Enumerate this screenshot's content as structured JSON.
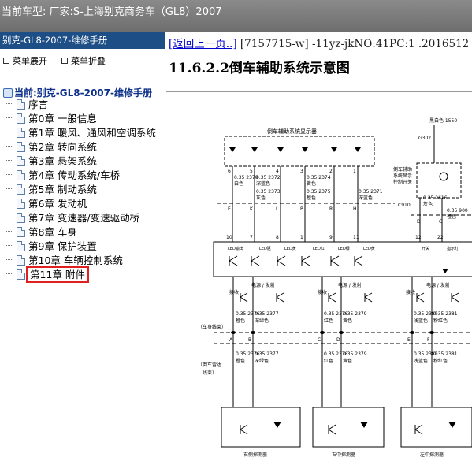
{
  "window": {
    "title": "当前车型:   厂家:S-上海别克商务车（GL8）2007"
  },
  "sidebar": {
    "header": "别克-GL8-2007-维修手册",
    "expand_all": "菜单展开",
    "collapse_all": "菜单折叠",
    "current": "当前:别克-GL8-2007-维修手册",
    "items": [
      {
        "label": "序言"
      },
      {
        "label": "第0章 一般信息"
      },
      {
        "label": "第1章 暖风、通风和空调系统"
      },
      {
        "label": "第2章 转向系统"
      },
      {
        "label": "第3章 悬架系统"
      },
      {
        "label": "第4章 传动系统/车桥"
      },
      {
        "label": "第5章 制动系统"
      },
      {
        "label": "第6章 发动机"
      },
      {
        "label": "第7章 变速器/变速驱动桥"
      },
      {
        "label": "第8章 车身"
      },
      {
        "label": "第9章 保护装置"
      },
      {
        "label": "第10章 车辆控制系统"
      },
      {
        "label": "第11章 附件",
        "selected": true
      }
    ]
  },
  "content": {
    "back_link": "[返回上一页..]",
    "doc_meta": " [7157715-w] -11yz-jkNO:41PC:1 .2016512",
    "page_title": "11.6.2.2倒车辅助系统示意图"
  },
  "diagram": {
    "display_title": "倒车辅助系统显示器",
    "top_wire": "黑白色 1550",
    "ground": "G302",
    "switch_label": [
      "倒车辅助",
      "系统显示",
      "控制开关"
    ],
    "connector_c910": "C910",
    "section_body_harness": "（车身线束）",
    "section_sensor_harness": [
      "（倒车雷达",
      "线束）"
    ],
    "power_label": "电源 / 发射",
    "receive_label": "接收",
    "sensor_labels": [
      "右侧探测器",
      "右中探测器",
      "左中探测器"
    ],
    "pin_top": [
      "6",
      "5",
      "4",
      "3",
      "2",
      "1"
    ],
    "pin_mid": [
      "10",
      "7",
      "8",
      "1",
      "9",
      "11",
      "12",
      "22"
    ],
    "wire_370s": [
      "0.35 2370",
      "0.35 2372",
      "0.35 2374",
      "0.35 2373",
      "0.35 2375",
      "0.35 2371"
    ],
    "wire_colors_a": [
      "白色",
      "深蓝色",
      "黄色",
      "灰色",
      "橙色",
      "深蓝色"
    ],
    "wire_2616": [
      "0.35 2616",
      "0.35 900"
    ],
    "wire_2616_colors": [
      "灰色",
      "橙色"
    ],
    "wires_lower": [
      "0.35 2376",
      "0.35 2377",
      "0.35 2378",
      "0.35 2379",
      "0.35 2380",
      "0.35 2381"
    ],
    "wires_lower_colors": [
      "橙色",
      "深绿色",
      "红色",
      "黄色",
      "浅蓝色",
      "粉红色"
    ],
    "led_labels": [
      "LED输出",
      "LED驱",
      "LED黄",
      "LED红",
      "LED绿",
      "LED黄"
    ],
    "switch_text": "开关",
    "indicator_text": "指示灯",
    "connector_letters_top": [
      "E",
      "K",
      "L",
      "P",
      "R",
      "H",
      "D",
      "C"
    ],
    "connector_letters_bot": [
      "A",
      "B",
      "C",
      "D",
      "E",
      "F"
    ]
  }
}
